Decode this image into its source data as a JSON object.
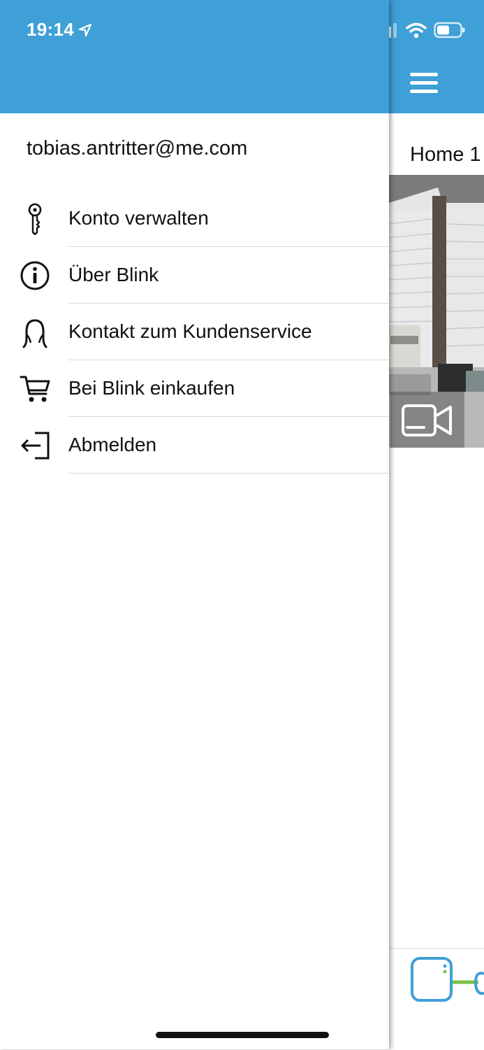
{
  "status_bar": {
    "time": "19:14",
    "icons": [
      "location-arrow-icon",
      "signal-icon",
      "wifi-icon",
      "battery-icon"
    ]
  },
  "drawer": {
    "account_email": "tobias.antritter@me.com",
    "items": [
      {
        "label": "Konto verwalten",
        "icon": "key-icon"
      },
      {
        "label": "Über Blink",
        "icon": "info-icon"
      },
      {
        "label": "Kontakt zum Kundenservice",
        "icon": "headset-icon"
      },
      {
        "label": "Bei Blink einkaufen",
        "icon": "cart-icon"
      },
      {
        "label": "Abmelden",
        "icon": "logout-icon"
      }
    ]
  },
  "main": {
    "system_title": "Home 1",
    "menu_icon": "hamburger-icon",
    "camera_overlay_icon": "video-camera-icon",
    "bottom_icon": "sync-module-icon"
  },
  "colors": {
    "header_blue": "#3f9fd7",
    "sync_module_blue": "#3f9fd7",
    "sync_module_green": "#7cc045"
  }
}
